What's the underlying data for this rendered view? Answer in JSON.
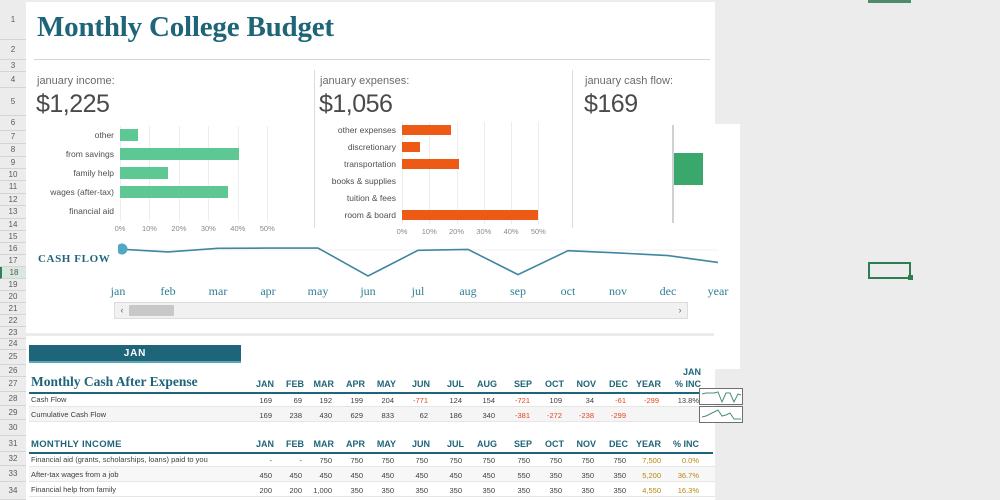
{
  "document": {
    "title": "Monthly College Budget",
    "row_numbers": [
      1,
      2,
      3,
      4,
      5,
      6,
      7,
      8,
      9,
      10,
      11,
      12,
      13,
      14,
      15,
      16,
      17,
      18,
      19,
      20,
      21,
      22,
      23,
      24,
      25,
      26,
      27,
      28,
      29,
      30,
      31,
      32,
      33,
      34
    ],
    "selected_row": 18
  },
  "summary": {
    "income": {
      "label": "january income:",
      "value": "$1,225"
    },
    "expenses": {
      "label": "january expenses:",
      "value": "$1,056"
    },
    "cash_flow": {
      "label": "january cash flow:",
      "value": "$169"
    }
  },
  "colors": {
    "title": "#1f6579",
    "income_bar": "#5ec894",
    "expense_bar": "#ec5a16",
    "cashflow_bar": "#3aa76d",
    "line": "#3e87a0",
    "negative": "#e8431f",
    "year": "#b8860b",
    "banner": "#1f6579"
  },
  "chart_data": [
    {
      "type": "bar",
      "orientation": "horizontal",
      "title": "january income:",
      "name": "income-chart",
      "categories": [
        "other",
        "from savings",
        "family help",
        "wages (after-tax)",
        "financial aid"
      ],
      "values": [
        6,
        40.5,
        16.3,
        36.7,
        0
      ],
      "xlabel": "",
      "ylabel": "",
      "xlim": [
        0,
        55
      ],
      "tick_labels": [
        "0%",
        "10%",
        "20%",
        "30%",
        "40%",
        "50%"
      ],
      "tick_values": [
        0,
        10,
        20,
        30,
        40,
        50
      ],
      "color": "#5ec894",
      "grid": true
    },
    {
      "type": "bar",
      "orientation": "horizontal",
      "title": "january expenses:",
      "name": "expenses-chart",
      "categories": [
        "other expenses",
        "discretionary",
        "transportation",
        "books & supplies",
        "tuition & fees",
        "room & board"
      ],
      "values": [
        17.8,
        6.5,
        20.8,
        0,
        0,
        49.7
      ],
      "xlabel": "",
      "ylabel": "",
      "xlim": [
        0,
        55
      ],
      "tick_labels": [
        "0%",
        "10%",
        "20%",
        "30%",
        "40%",
        "50%"
      ],
      "tick_values": [
        0,
        10,
        20,
        30,
        40,
        50
      ],
      "color": "#ec5a16",
      "grid": true
    },
    {
      "type": "bar",
      "orientation": "vertical",
      "title": "january cash flow:",
      "name": "cashflow-waterfall",
      "categories": [
        "january"
      ],
      "values": [
        169
      ],
      "xlabel": "",
      "ylabel": "",
      "color": "#3aa76d",
      "grid": false
    },
    {
      "type": "line",
      "name": "cash-flow-line",
      "title": "CASH FLOW",
      "categories": [
        "jan",
        "feb",
        "mar",
        "apr",
        "may",
        "jun",
        "jul",
        "aug",
        "sep",
        "oct",
        "nov",
        "dec",
        "year"
      ],
      "values": [
        169,
        69,
        192,
        199,
        204,
        -771,
        124,
        154,
        -721,
        109,
        34,
        -61,
        -299
      ],
      "xlabel": "",
      "ylabel": "",
      "grid": false,
      "marker_at": "jan",
      "color": "#3e87a0"
    }
  ],
  "cash_flow_line": {
    "label": "CASH FLOW",
    "months": [
      "jan",
      "feb",
      "mar",
      "apr",
      "may",
      "jun",
      "jul",
      "aug",
      "sep",
      "oct",
      "nov",
      "dec",
      "year"
    ]
  },
  "banner": {
    "label": "JAN"
  },
  "table_cash": {
    "title": "Monthly Cash After Expense",
    "columns": [
      "JAN",
      "FEB",
      "MAR",
      "APR",
      "MAY",
      "JUN",
      "JUL",
      "AUG",
      "SEP",
      "OCT",
      "NOV",
      "DEC",
      "YEAR"
    ],
    "last_column": "JAN\n% INC",
    "last_column_line1": "JAN",
    "last_column_line2": "% INC",
    "rows": [
      {
        "label": "Cash Flow",
        "values": [
          "169",
          "69",
          "192",
          "199",
          "204",
          "-771",
          "124",
          "154",
          "-721",
          "109",
          "34",
          "-61",
          "-299"
        ],
        "pct": "13.8%"
      },
      {
        "label": "Cumulative Cash Flow",
        "values": [
          "169",
          "238",
          "430",
          "629",
          "833",
          "62",
          "186",
          "340",
          "-381",
          "-272",
          "-238",
          "-299",
          ""
        ],
        "pct": ""
      }
    ]
  },
  "table_income": {
    "title": "MONTHLY INCOME",
    "columns": [
      "JAN",
      "FEB",
      "MAR",
      "APR",
      "MAY",
      "JUN",
      "JUL",
      "AUG",
      "SEP",
      "OCT",
      "NOV",
      "DEC",
      "YEAR",
      "% INC"
    ],
    "rows": [
      {
        "label": "Financial aid (grants, scholarships, loans) paid to you",
        "values": [
          "-",
          "-",
          "750",
          "750",
          "750",
          "750",
          "750",
          "750",
          "750",
          "750",
          "750",
          "750"
        ],
        "year": "7,500",
        "pct": "0.0%"
      },
      {
        "label": "After-tax wages from a job",
        "values": [
          "450",
          "450",
          "450",
          "450",
          "450",
          "450",
          "450",
          "450",
          "550",
          "350",
          "350",
          "350"
        ],
        "year": "5,200",
        "pct": "36.7%"
      },
      {
        "label": "Financial help from family",
        "values": [
          "200",
          "200",
          "1,000",
          "350",
          "350",
          "350",
          "350",
          "350",
          "350",
          "350",
          "350",
          "350"
        ],
        "year": "4,550",
        "pct": "16.3%"
      }
    ]
  },
  "scrollbar": {
    "left_arrow": "‹",
    "right_arrow": "›"
  }
}
